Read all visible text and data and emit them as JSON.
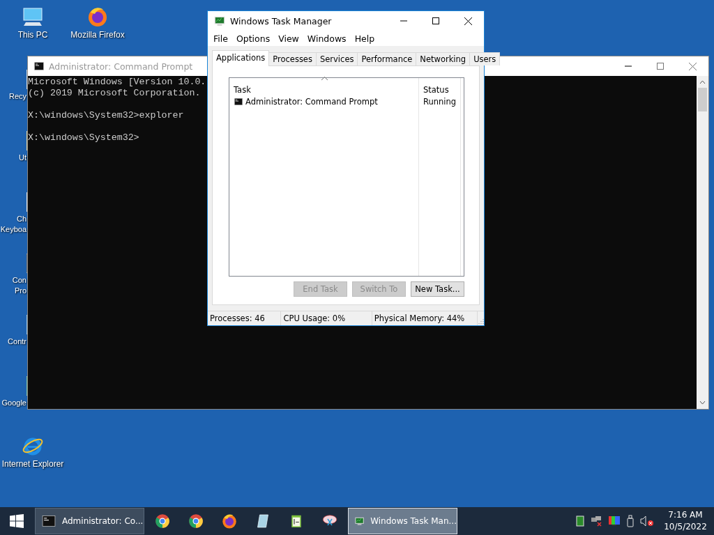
{
  "desktop_icons": [
    {
      "kind": "computer",
      "lines": [
        "This PC"
      ]
    },
    {
      "kind": "firefox",
      "lines": [
        "Mozilla Firefox"
      ]
    },
    {
      "kind": "recycle",
      "lines": [
        "Recy"
      ]
    },
    {
      "kind": "folder",
      "lines": [
        "Ut"
      ]
    },
    {
      "kind": "keyboard",
      "lines": [
        "Ch",
        "Keyboa"
      ]
    },
    {
      "kind": "console",
      "lines": [
        "Con",
        "Pro"
      ]
    },
    {
      "kind": "control",
      "lines": [
        "Contr"
      ]
    },
    {
      "kind": "chrome",
      "lines": [
        "Google"
      ]
    },
    {
      "kind": "ie",
      "lines": [
        "Internet Explorer"
      ]
    }
  ],
  "cmd_window": {
    "title": "Administrator: Command Prompt",
    "blocks": [
      [
        "Microsoft Windows [Version 10.0.",
        "(c) 2019 Microsoft Corporation."
      ],
      [
        "X:\\windows\\System32>explorer"
      ],
      [
        "X:\\windows\\System32>"
      ]
    ]
  },
  "task_manager": {
    "title": "Windows Task Manager",
    "menu": [
      "File",
      "Options",
      "View",
      "Windows",
      "Help"
    ],
    "tabs": [
      {
        "label": "Applications",
        "selected": true
      },
      {
        "label": "Processes",
        "selected": false
      },
      {
        "label": "Services",
        "selected": false
      },
      {
        "label": "Performance",
        "selected": false
      },
      {
        "label": "Networking",
        "selected": false
      },
      {
        "label": "Users",
        "selected": false
      }
    ],
    "columns": [
      "Task",
      "Status"
    ],
    "rows": [
      {
        "task": "Administrator: Command Prompt",
        "status": "Running"
      }
    ],
    "buttons": [
      {
        "label": "End Task",
        "disabled": true
      },
      {
        "label": "Switch To",
        "disabled": true
      },
      {
        "label": "New Task...",
        "disabled": false
      }
    ],
    "status_bar": [
      "Processes: 46",
      "CPU Usage: 0%",
      "Physical Memory: 44%"
    ]
  },
  "taskbar": {
    "items": [
      {
        "kind": "window",
        "label": "Administrator: Co...",
        "selected": false
      },
      {
        "kind": "pin"
      },
      {
        "kind": "pin"
      },
      {
        "kind": "pin"
      },
      {
        "kind": "pin"
      },
      {
        "kind": "pin"
      },
      {
        "kind": "pin"
      },
      {
        "kind": "window",
        "label": "Windows Task Man...",
        "selected": true
      }
    ],
    "time": "7:16 AM",
    "date": "10/5/2022"
  }
}
